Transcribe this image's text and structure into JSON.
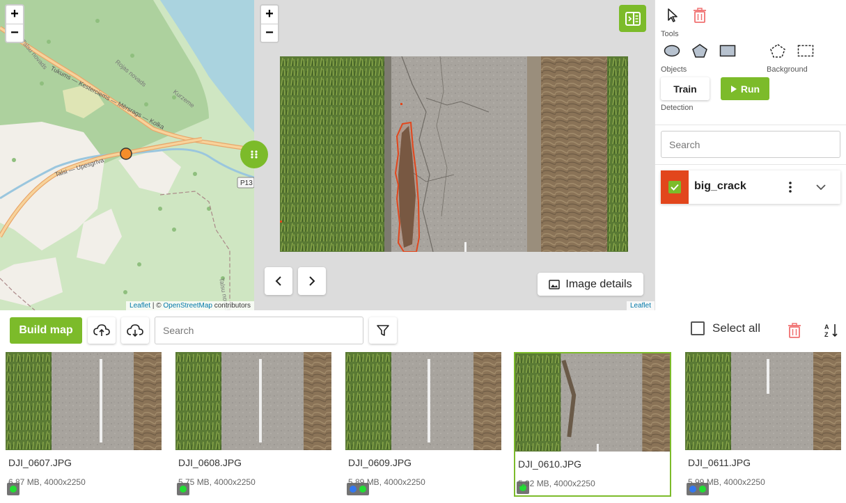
{
  "map": {
    "zoom_in": "+",
    "zoom_out": "−",
    "labels": {
      "road_main": "Tukums — Kesterciems — Mērsrags — Kolka",
      "road_secondary": "Talsi — Upesgrīva",
      "road_ref": "P13",
      "area_1": "Rojas novads",
      "area_2": "Kurzeme",
      "area_3": "Talsu novads",
      "area_4": "Talsu novads"
    },
    "attribution": {
      "leaflet": "Leaflet",
      "separator": " | © ",
      "osm": "OpenStreetMap",
      "suffix": " contributors"
    }
  },
  "viewer": {
    "zoom_in": "+",
    "zoom_out": "−",
    "image_details_label": "Image details",
    "attribution": "Leaflet"
  },
  "sidebar": {
    "tools_label": "Tools",
    "objects_label": "Objects",
    "background_label": "Background",
    "detection_label": "Detection",
    "train_label": "Train",
    "run_label": "Run",
    "search_placeholder": "Search",
    "classes": [
      {
        "name": "big_crack",
        "color": "#e2461c",
        "checked": true
      }
    ]
  },
  "toolbar": {
    "build_map_label": "Build map",
    "search_placeholder": "Search",
    "select_all_label": "Select all"
  },
  "thumbnails": [
    {
      "name": "DJI_0607.JPG",
      "meta": "6.87 MB, 4000x2250",
      "dots": [
        "#22dd33"
      ],
      "selected": false
    },
    {
      "name": "DJI_0608.JPG",
      "meta": "5.75 MB, 4000x2250",
      "dots": [
        "#22dd33"
      ],
      "selected": false
    },
    {
      "name": "DJI_0609.JPG",
      "meta": "5.89 MB, 4000x2250",
      "dots": [
        "#3377ee",
        "#22dd33"
      ],
      "selected": false
    },
    {
      "name": "DJI_0610.JPG",
      "meta": "5.92 MB, 4000x2250",
      "dots": [
        "#22dd33"
      ],
      "selected": true
    },
    {
      "name": "DJI_0611.JPG",
      "meta": "5.99 MB, 4000x2250",
      "dots": [
        "#3377ee",
        "#22dd33"
      ],
      "selected": false
    }
  ],
  "colors": {
    "accent_green": "#7cbb2a",
    "delete_red": "#f07070",
    "class_red": "#e2461c"
  }
}
